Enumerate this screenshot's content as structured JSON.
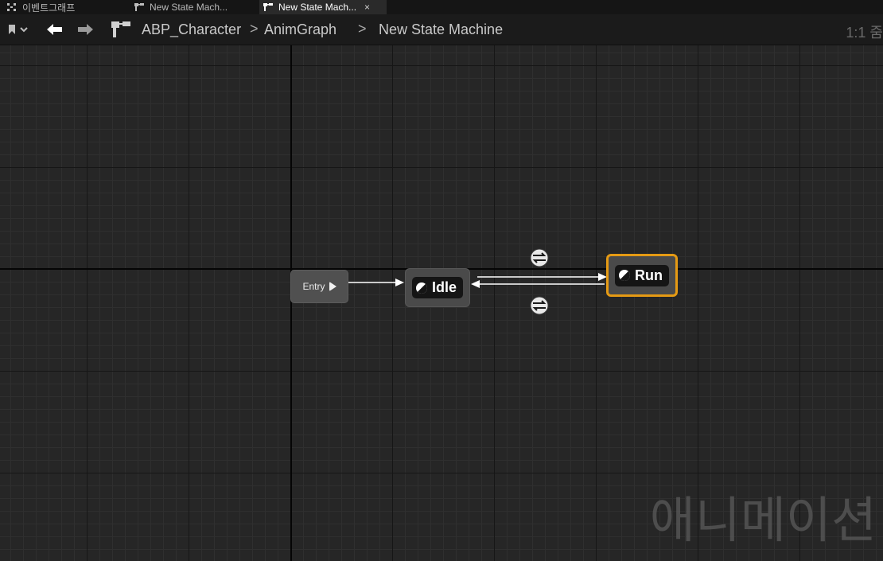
{
  "tabs": [
    {
      "label": "이벤트그래프",
      "icon": "event-graph-icon",
      "active": false
    },
    {
      "label": "New State Mach...",
      "icon": "state-machine-icon",
      "active": false
    },
    {
      "label": "New State Mach...",
      "icon": "state-machine-icon",
      "active": true
    }
  ],
  "tab_close": "×",
  "breadcrumb": {
    "items": [
      "ABP_Character",
      "AnimGraph",
      "New State Machine"
    ],
    "separator": ">"
  },
  "zoom_label": "1:1 줌",
  "graph": {
    "entry_label": "Entry",
    "states": [
      {
        "name": "Idle",
        "selected": false
      },
      {
        "name": "Run",
        "selected": true
      }
    ],
    "transitions": [
      {
        "from": "Entry",
        "to": "Idle"
      },
      {
        "from": "Idle",
        "to": "Run"
      },
      {
        "from": "Run",
        "to": "Idle"
      }
    ]
  },
  "watermark": "애니메이션",
  "colors": {
    "selection": "#e59a14",
    "background": "#262626",
    "node": "#4a4a4a"
  }
}
